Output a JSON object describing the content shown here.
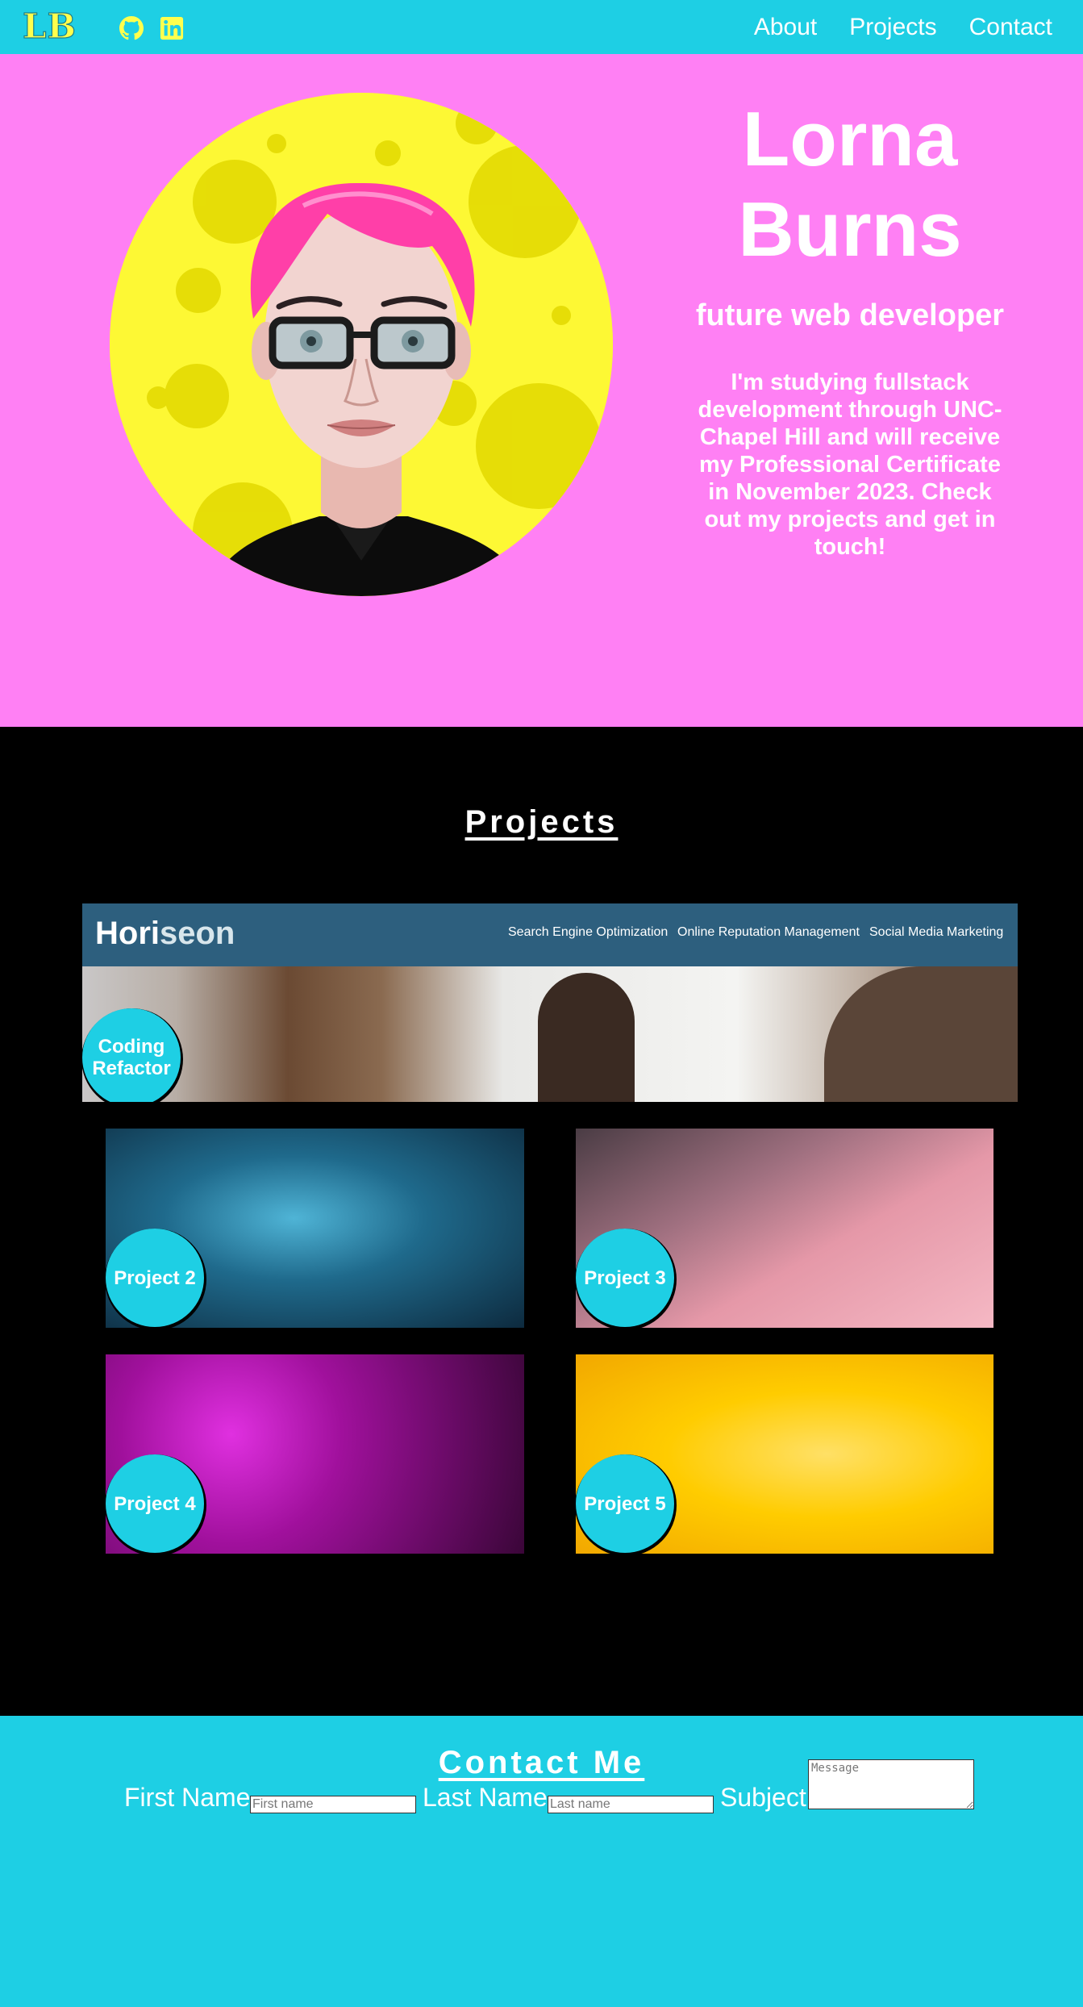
{
  "nav": {
    "logo": "LB",
    "links": [
      "About",
      "Projects",
      "Contact"
    ],
    "icons": [
      "github-icon",
      "linkedin-icon"
    ],
    "accent": "#1ecfe4",
    "logo_color": "#ffff4d"
  },
  "hero": {
    "name_line1": "Lorna",
    "name_line2": "Burns",
    "role": "future web developer",
    "bio": "I'm studying fullstack development through UNC-Chapel Hill and will receive my Professional Certificate in November 2023. Check out my projects and get in touch!",
    "background": "#ff80f4"
  },
  "projects": {
    "title": "Projects",
    "featured": {
      "label": "Coding Refactor",
      "site_brand": "Horiseon",
      "site_nav": [
        "Search Engine Optimization",
        "Online Reputation Management",
        "Social Media Marketing"
      ]
    },
    "items": [
      {
        "label": "Project 2"
      },
      {
        "label": "Project 3"
      },
      {
        "label": "Project 4"
      },
      {
        "label": "Project 5"
      }
    ]
  },
  "contact": {
    "title": "Contact Me",
    "first_name_label": "First Name",
    "first_name_placeholder": "First name",
    "last_name_label": "Last Name",
    "last_name_placeholder": "Last name",
    "subject_label": "Subject",
    "message_placeholder": "Message"
  }
}
